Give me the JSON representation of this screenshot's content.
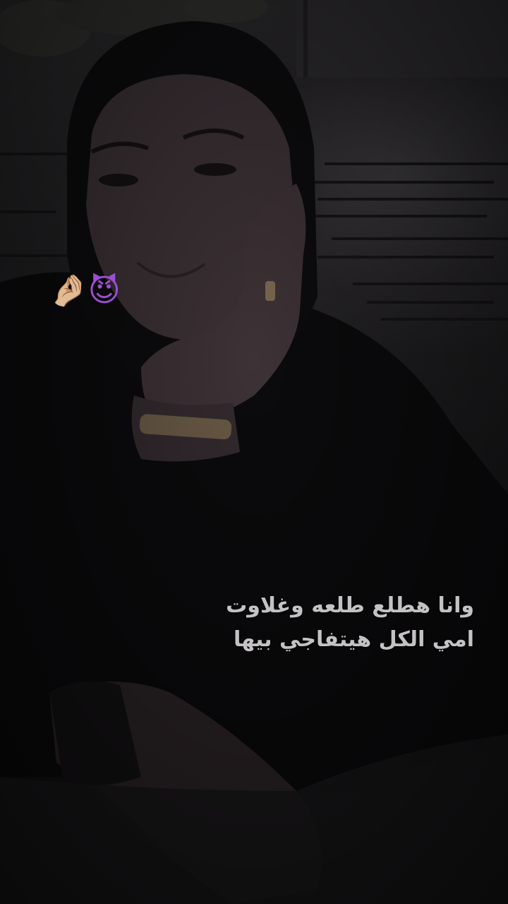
{
  "overlay": {
    "emoji_hand": "🤌🏼",
    "emoji_devil": "😈"
  },
  "caption": {
    "line1": "وانا هطلع طلعه وغلاوت",
    "line2": "امي الكل هيتفاجي بيها"
  },
  "colors": {
    "caption_text": "#c4c2c4",
    "background": "#0d0c0e"
  }
}
